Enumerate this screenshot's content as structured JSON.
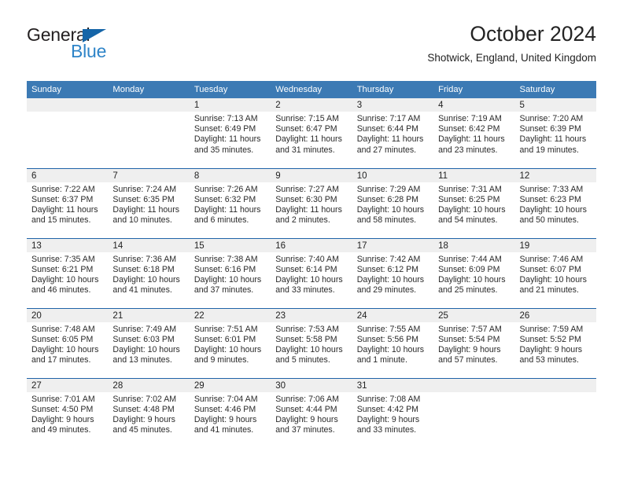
{
  "brand": {
    "name_part1": "General",
    "name_part2": "Blue",
    "triangle_color": "#1565a8",
    "blue_color": "#2e84c8"
  },
  "header": {
    "title": "October 2024",
    "subtitle": "Shotwick, England, United Kingdom"
  },
  "theme": {
    "header_blue": "#3c7ab4",
    "row_divider_blue": "#1f63a8",
    "daynum_band": "#efefef"
  },
  "weekday_headers": [
    "Sunday",
    "Monday",
    "Tuesday",
    "Wednesday",
    "Thursday",
    "Friday",
    "Saturday"
  ],
  "labels": {
    "sunrise_prefix": "Sunrise:",
    "sunset_prefix": "Sunset:",
    "daylight_prefix": "Daylight:"
  },
  "weeks": [
    [
      {
        "day": "",
        "sunrise": "",
        "sunset": "",
        "daylight_line1": "",
        "daylight_line2": "",
        "empty": true
      },
      {
        "day": "",
        "sunrise": "",
        "sunset": "",
        "daylight_line1": "",
        "daylight_line2": "",
        "empty": true
      },
      {
        "day": "1",
        "sunrise": "Sunrise: 7:13 AM",
        "sunset": "Sunset: 6:49 PM",
        "daylight_line1": "Daylight: 11 hours",
        "daylight_line2": "and 35 minutes.",
        "empty": false
      },
      {
        "day": "2",
        "sunrise": "Sunrise: 7:15 AM",
        "sunset": "Sunset: 6:47 PM",
        "daylight_line1": "Daylight: 11 hours",
        "daylight_line2": "and 31 minutes.",
        "empty": false
      },
      {
        "day": "3",
        "sunrise": "Sunrise: 7:17 AM",
        "sunset": "Sunset: 6:44 PM",
        "daylight_line1": "Daylight: 11 hours",
        "daylight_line2": "and 27 minutes.",
        "empty": false
      },
      {
        "day": "4",
        "sunrise": "Sunrise: 7:19 AM",
        "sunset": "Sunset: 6:42 PM",
        "daylight_line1": "Daylight: 11 hours",
        "daylight_line2": "and 23 minutes.",
        "empty": false
      },
      {
        "day": "5",
        "sunrise": "Sunrise: 7:20 AM",
        "sunset": "Sunset: 6:39 PM",
        "daylight_line1": "Daylight: 11 hours",
        "daylight_line2": "and 19 minutes.",
        "empty": false
      }
    ],
    [
      {
        "day": "6",
        "sunrise": "Sunrise: 7:22 AM",
        "sunset": "Sunset: 6:37 PM",
        "daylight_line1": "Daylight: 11 hours",
        "daylight_line2": "and 15 minutes.",
        "empty": false
      },
      {
        "day": "7",
        "sunrise": "Sunrise: 7:24 AM",
        "sunset": "Sunset: 6:35 PM",
        "daylight_line1": "Daylight: 11 hours",
        "daylight_line2": "and 10 minutes.",
        "empty": false
      },
      {
        "day": "8",
        "sunrise": "Sunrise: 7:26 AM",
        "sunset": "Sunset: 6:32 PM",
        "daylight_line1": "Daylight: 11 hours",
        "daylight_line2": "and 6 minutes.",
        "empty": false
      },
      {
        "day": "9",
        "sunrise": "Sunrise: 7:27 AM",
        "sunset": "Sunset: 6:30 PM",
        "daylight_line1": "Daylight: 11 hours",
        "daylight_line2": "and 2 minutes.",
        "empty": false
      },
      {
        "day": "10",
        "sunrise": "Sunrise: 7:29 AM",
        "sunset": "Sunset: 6:28 PM",
        "daylight_line1": "Daylight: 10 hours",
        "daylight_line2": "and 58 minutes.",
        "empty": false
      },
      {
        "day": "11",
        "sunrise": "Sunrise: 7:31 AM",
        "sunset": "Sunset: 6:25 PM",
        "daylight_line1": "Daylight: 10 hours",
        "daylight_line2": "and 54 minutes.",
        "empty": false
      },
      {
        "day": "12",
        "sunrise": "Sunrise: 7:33 AM",
        "sunset": "Sunset: 6:23 PM",
        "daylight_line1": "Daylight: 10 hours",
        "daylight_line2": "and 50 minutes.",
        "empty": false
      }
    ],
    [
      {
        "day": "13",
        "sunrise": "Sunrise: 7:35 AM",
        "sunset": "Sunset: 6:21 PM",
        "daylight_line1": "Daylight: 10 hours",
        "daylight_line2": "and 46 minutes.",
        "empty": false
      },
      {
        "day": "14",
        "sunrise": "Sunrise: 7:36 AM",
        "sunset": "Sunset: 6:18 PM",
        "daylight_line1": "Daylight: 10 hours",
        "daylight_line2": "and 41 minutes.",
        "empty": false
      },
      {
        "day": "15",
        "sunrise": "Sunrise: 7:38 AM",
        "sunset": "Sunset: 6:16 PM",
        "daylight_line1": "Daylight: 10 hours",
        "daylight_line2": "and 37 minutes.",
        "empty": false
      },
      {
        "day": "16",
        "sunrise": "Sunrise: 7:40 AM",
        "sunset": "Sunset: 6:14 PM",
        "daylight_line1": "Daylight: 10 hours",
        "daylight_line2": "and 33 minutes.",
        "empty": false
      },
      {
        "day": "17",
        "sunrise": "Sunrise: 7:42 AM",
        "sunset": "Sunset: 6:12 PM",
        "daylight_line1": "Daylight: 10 hours",
        "daylight_line2": "and 29 minutes.",
        "empty": false
      },
      {
        "day": "18",
        "sunrise": "Sunrise: 7:44 AM",
        "sunset": "Sunset: 6:09 PM",
        "daylight_line1": "Daylight: 10 hours",
        "daylight_line2": "and 25 minutes.",
        "empty": false
      },
      {
        "day": "19",
        "sunrise": "Sunrise: 7:46 AM",
        "sunset": "Sunset: 6:07 PM",
        "daylight_line1": "Daylight: 10 hours",
        "daylight_line2": "and 21 minutes.",
        "empty": false
      }
    ],
    [
      {
        "day": "20",
        "sunrise": "Sunrise: 7:48 AM",
        "sunset": "Sunset: 6:05 PM",
        "daylight_line1": "Daylight: 10 hours",
        "daylight_line2": "and 17 minutes.",
        "empty": false
      },
      {
        "day": "21",
        "sunrise": "Sunrise: 7:49 AM",
        "sunset": "Sunset: 6:03 PM",
        "daylight_line1": "Daylight: 10 hours",
        "daylight_line2": "and 13 minutes.",
        "empty": false
      },
      {
        "day": "22",
        "sunrise": "Sunrise: 7:51 AM",
        "sunset": "Sunset: 6:01 PM",
        "daylight_line1": "Daylight: 10 hours",
        "daylight_line2": "and 9 minutes.",
        "empty": false
      },
      {
        "day": "23",
        "sunrise": "Sunrise: 7:53 AM",
        "sunset": "Sunset: 5:58 PM",
        "daylight_line1": "Daylight: 10 hours",
        "daylight_line2": "and 5 minutes.",
        "empty": false
      },
      {
        "day": "24",
        "sunrise": "Sunrise: 7:55 AM",
        "sunset": "Sunset: 5:56 PM",
        "daylight_line1": "Daylight: 10 hours",
        "daylight_line2": "and 1 minute.",
        "empty": false
      },
      {
        "day": "25",
        "sunrise": "Sunrise: 7:57 AM",
        "sunset": "Sunset: 5:54 PM",
        "daylight_line1": "Daylight: 9 hours",
        "daylight_line2": "and 57 minutes.",
        "empty": false
      },
      {
        "day": "26",
        "sunrise": "Sunrise: 7:59 AM",
        "sunset": "Sunset: 5:52 PM",
        "daylight_line1": "Daylight: 9 hours",
        "daylight_line2": "and 53 minutes.",
        "empty": false
      }
    ],
    [
      {
        "day": "27",
        "sunrise": "Sunrise: 7:01 AM",
        "sunset": "Sunset: 4:50 PM",
        "daylight_line1": "Daylight: 9 hours",
        "daylight_line2": "and 49 minutes.",
        "empty": false
      },
      {
        "day": "28",
        "sunrise": "Sunrise: 7:02 AM",
        "sunset": "Sunset: 4:48 PM",
        "daylight_line1": "Daylight: 9 hours",
        "daylight_line2": "and 45 minutes.",
        "empty": false
      },
      {
        "day": "29",
        "sunrise": "Sunrise: 7:04 AM",
        "sunset": "Sunset: 4:46 PM",
        "daylight_line1": "Daylight: 9 hours",
        "daylight_line2": "and 41 minutes.",
        "empty": false
      },
      {
        "day": "30",
        "sunrise": "Sunrise: 7:06 AM",
        "sunset": "Sunset: 4:44 PM",
        "daylight_line1": "Daylight: 9 hours",
        "daylight_line2": "and 37 minutes.",
        "empty": false
      },
      {
        "day": "31",
        "sunrise": "Sunrise: 7:08 AM",
        "sunset": "Sunset: 4:42 PM",
        "daylight_line1": "Daylight: 9 hours",
        "daylight_line2": "and 33 minutes.",
        "empty": false
      },
      {
        "day": "",
        "sunrise": "",
        "sunset": "",
        "daylight_line1": "",
        "daylight_line2": "",
        "empty": true
      },
      {
        "day": "",
        "sunrise": "",
        "sunset": "",
        "daylight_line1": "",
        "daylight_line2": "",
        "empty": true
      }
    ]
  ]
}
